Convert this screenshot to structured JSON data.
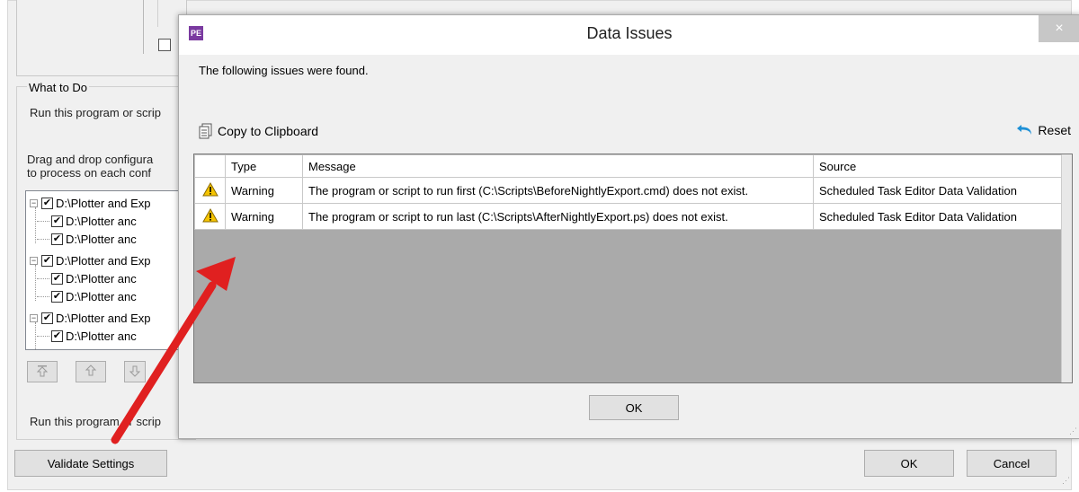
{
  "background_window": {
    "group_title": "What to Do",
    "run_first_label": "Run this program or scrip",
    "drag_text_line1": "Drag and drop configura",
    "drag_text_line2": "to process on each conf",
    "tree_items": [
      {
        "label": "D:\\Plotter and Exp",
        "level": 0,
        "checked": true
      },
      {
        "label": "D:\\Plotter anc",
        "level": 1,
        "checked": true
      },
      {
        "label": "D:\\Plotter anc",
        "level": 1,
        "checked": true
      },
      {
        "label": "D:\\Plotter and Exp",
        "level": 0,
        "checked": true
      },
      {
        "label": "D:\\Plotter anc",
        "level": 1,
        "checked": true
      },
      {
        "label": "D:\\Plotter anc",
        "level": 1,
        "checked": true
      },
      {
        "label": "D:\\Plotter and Exp",
        "level": 0,
        "checked": true
      },
      {
        "label": "D:\\Plotter anc",
        "level": 1,
        "checked": true
      }
    ],
    "run_last_label": "Run this program or scrip",
    "validate_button": "Validate Settings",
    "ok_button": "OK",
    "cancel_button": "Cancel"
  },
  "dialog": {
    "icon_text": "PE",
    "title": "Data Issues",
    "close_glyph": "×",
    "message": "The following issues were found.",
    "copy_label": "Copy to Clipboard",
    "reset_label": "Reset",
    "columns": [
      "Type",
      "Message",
      "Source"
    ],
    "rows": [
      {
        "type": "Warning",
        "message": "The program or script to run first (C:\\Scripts\\BeforeNightlyExport.cmd) does not exist.",
        "source": "Scheduled Task Editor Data Validation"
      },
      {
        "type": "Warning",
        "message": "The program or script to run last (C:\\Scripts\\AfterNightlyExport.ps) does not exist.",
        "source": "Scheduled Task Editor Data Validation"
      }
    ],
    "ok_button": "OK"
  },
  "colors": {
    "annotation_arrow": "#e02020",
    "warning_icon": "#f5c400",
    "grid_empty": "#aaaaaa",
    "reset_icon": "#1e90d6"
  },
  "icons": {
    "warning": "warning-icon",
    "copy": "clipboard-icon",
    "reset": "undo-icon",
    "move_top": "move-to-top-icon",
    "move_up": "move-up-icon",
    "move_down": "move-down-icon"
  }
}
